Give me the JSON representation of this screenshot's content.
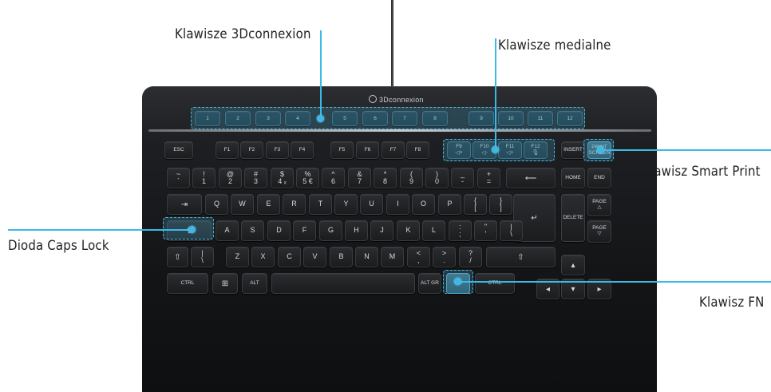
{
  "callouts": {
    "keys_3dconnexion": "Klawisze 3Dconnexion",
    "media_keys": "Klawisze medialne",
    "smart_print": "Klawisz Smart Print",
    "caps_lock": "Dioda Caps Lock",
    "fn_key": "Klawisz FN"
  },
  "brand": "3Dconnexion",
  "keys3d": [
    "1",
    "2",
    "3",
    "4",
    "5",
    "6",
    "7",
    "8",
    "9",
    "10",
    "11",
    "12"
  ],
  "frow": {
    "esc": "ESC",
    "f": [
      "F1",
      "F2",
      "F3",
      "F4",
      "F5",
      "F6",
      "F7",
      "F8"
    ],
    "media": [
      {
        "label": "F9",
        "icon": "mute-icon",
        "glyph": "◁×"
      },
      {
        "label": "F10",
        "icon": "volume-down-icon",
        "glyph": "◁-"
      },
      {
        "label": "F11",
        "icon": "volume-up-icon",
        "glyph": "◁+"
      },
      {
        "label": "F12",
        "icon": "microphone-icon",
        "glyph": "🎙"
      }
    ],
    "insert": "INSERT",
    "print": "PRINT SCREEN"
  },
  "numrow": [
    {
      "top": "~",
      "bot": "`"
    },
    {
      "top": "!",
      "bot": "1"
    },
    {
      "top": "@",
      "bot": "2"
    },
    {
      "top": "#",
      "bot": "3"
    },
    {
      "top": "$",
      "bot": "4 ₓ"
    },
    {
      "top": "%",
      "bot": "5 €"
    },
    {
      "top": "^",
      "bot": "6"
    },
    {
      "top": "&",
      "bot": "7"
    },
    {
      "top": "*",
      "bot": "8"
    },
    {
      "top": "(",
      "bot": "9"
    },
    {
      "top": ")",
      "bot": "0"
    },
    {
      "top": "_",
      "bot": "-"
    },
    {
      "top": "+",
      "bot": "="
    }
  ],
  "qrow": [
    "Q",
    "W",
    "E",
    "R",
    "T",
    "Y",
    "U",
    "I",
    "O",
    "P"
  ],
  "qrow_brackets": [
    {
      "top": "{",
      "bot": "["
    },
    {
      "top": "}",
      "bot": "]"
    }
  ],
  "arow": [
    "A",
    "S",
    "D",
    "F",
    "G",
    "H",
    "J",
    "K",
    "L"
  ],
  "arow_punct": [
    {
      "top": ":",
      "bot": ";"
    },
    {
      "top": "\"",
      "bot": "'"
    },
    {
      "top": "|",
      "bot": "\\"
    }
  ],
  "zrow_left": {
    "top": "|",
    "bot": "\\"
  },
  "zrow": [
    "Z",
    "X",
    "C",
    "V",
    "B",
    "N",
    "M"
  ],
  "zrow_punct": [
    {
      "top": "<",
      "bot": ","
    },
    {
      "top": ">",
      "bot": "."
    },
    {
      "top": "?",
      "bot": "/"
    }
  ],
  "bottom": {
    "ctrl_left": "CTRL",
    "alt": "ALT",
    "altgr": "ALT GR",
    "fn": "FN",
    "ctrl_right": "CTRL"
  },
  "nav": {
    "home": "HOME",
    "end": "END",
    "delete": "DELETE",
    "page_up": "PAGE",
    "page_down": "PAGE"
  },
  "colors": {
    "accent": "#3cb9e6",
    "body": "#141517"
  }
}
